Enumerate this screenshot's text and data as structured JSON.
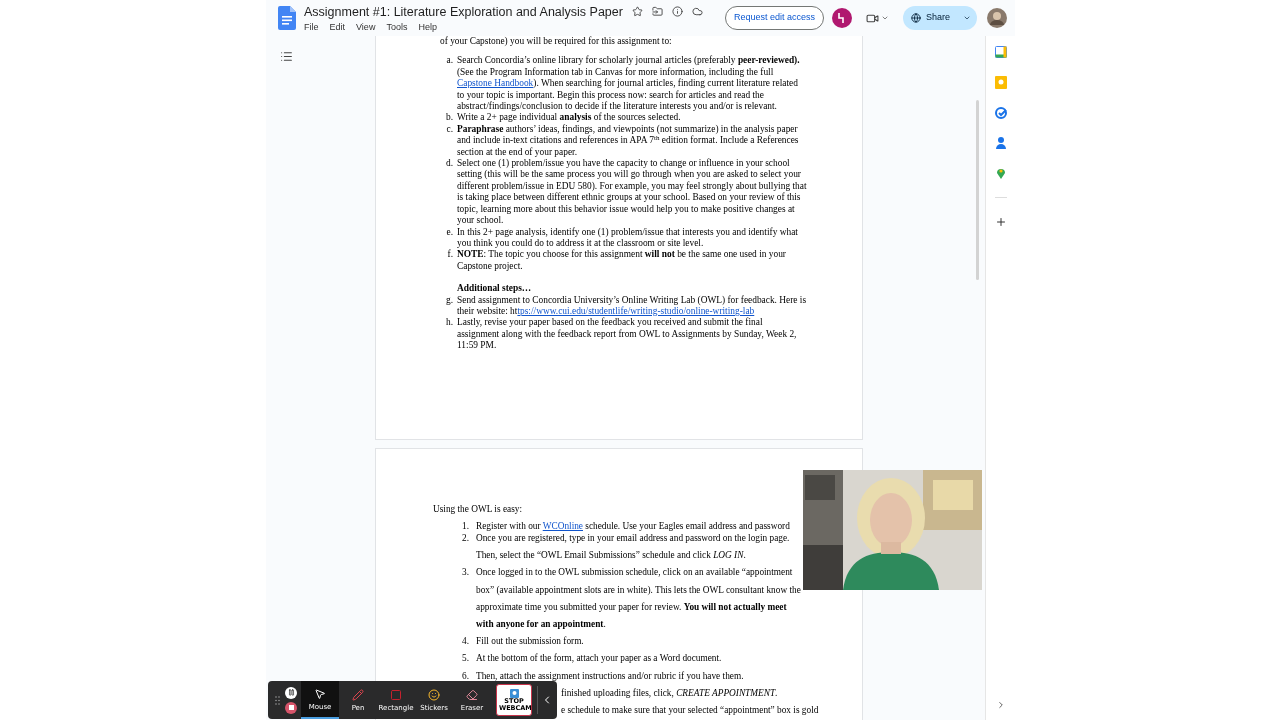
{
  "document": {
    "title": "Assignment #1: Literature Exploration and Analysis Paper",
    "menus": [
      "File",
      "Edit",
      "View",
      "Tools",
      "Help"
    ],
    "request_button": "Request edit access",
    "share_button": "Share"
  },
  "page1": {
    "lead": "of your Capstone) you will be required for this assignment to:",
    "items": [
      {
        "kind": "item",
        "marker": "a.",
        "parts": [
          {
            "kind": "text",
            "text": "Search Concordia’s online library for scholarly journal articles (preferably **peer-reviewed).** (See the Program Information tab in Canvas for more information, including the full "
          },
          {
            "kind": "link",
            "text": "Capstone Handbook"
          },
          {
            "kind": "text",
            "text": "). When searching for journal articles, finding current literature related to your topic is important. Begin this process now: search for articles and read the abstract/findings/conclusion to decide if the literature interests you and/or is relevant."
          }
        ]
      },
      {
        "kind": "item",
        "marker": "b.",
        "parts": [
          {
            "kind": "text",
            "text": "Write a 2+ page individual **analysis** of the sources selected."
          }
        ]
      },
      {
        "kind": "item",
        "marker": "c.",
        "parts": [
          {
            "kind": "text",
            "text": "**Paraphrase** authors’ ideas, findings, and viewpoints (not summarize) in the analysis paper and include in-text citations and references in APA 7$^{th}$ edition format. Include a References section at the end of your paper."
          }
        ]
      },
      {
        "kind": "item",
        "marker": "d.",
        "parts": [
          {
            "kind": "text",
            "text": "Select one (1) problem/issue you have the capacity to change or influence in your school setting (this will be the same process you will go through when you are asked to select your different problem/issue in EDU 580). For example, you may feel strongly about bullying that is taking place between different ethnic groups at your school. Based on your review of this topic, learning more about this behavior issue would help you to make positive changes at your school."
          }
        ]
      },
      {
        "kind": "item",
        "marker": "e.",
        "parts": [
          {
            "kind": "text",
            "text": "In this 2+ page analysis, identify one (1) problem/issue that interests you and identify what you think you could do to address it at the classroom or site level."
          }
        ]
      },
      {
        "kind": "item",
        "marker": "f.",
        "parts": [
          {
            "kind": "text",
            "text": "**NOTE**: The topic you choose for this assignment **will not** be the same one used in your Capstone project."
          }
        ]
      },
      {
        "kind": "heading",
        "text": "Additional steps…"
      },
      {
        "kind": "item",
        "marker": "g.",
        "parts": [
          {
            "kind": "text",
            "text": "Send assignment to Concordia University’s Online Writing Lab (OWL) for feedback. Here is their website: ht"
          },
          {
            "kind": "link",
            "text": "tps://www.cui.edu/studentlife/writing-studio/online-writing-lab"
          }
        ]
      },
      {
        "kind": "item",
        "marker": "h.",
        "parts": [
          {
            "kind": "text",
            "text": "Lastly, revise your paper based on the feedback you received and submit the final assignment along with the feedback report from OWL to Assignments by Sunday, Week 2, 11:59 PM."
          }
        ]
      }
    ]
  },
  "page2": {
    "intro": "Using the OWL is easy:",
    "steps": [
      {
        "kind": "full",
        "marker": "1.",
        "parts": [
          {
            "kind": "text",
            "text": "Register with our "
          },
          {
            "kind": "link",
            "text": "WCOnline"
          },
          {
            "kind": "text",
            "text": " schedule. Use your Eagles email address and password"
          }
        ]
      },
      {
        "kind": "full",
        "marker": "2.",
        "parts": [
          {
            "kind": "text",
            "text": "Once you are registered, type in your email address and password on the login page. Then, select the “OWL Email Submissions” schedule and click *LOG IN*."
          }
        ]
      },
      {
        "kind": "full",
        "marker": "3.",
        "parts": [
          {
            "kind": "text",
            "text": "Once logged in to the OWL submission schedule, click on an available “appointment box” (available appointment slots are in white). This lets the OWL consultant know the approximate time you submitted your paper for review. **You will not actually meet with anyone for an appointment**."
          }
        ]
      },
      {
        "kind": "full",
        "marker": "4.",
        "parts": [
          {
            "kind": "text",
            "text": "Fill out the submission form."
          }
        ]
      },
      {
        "kind": "full",
        "marker": "5.",
        "parts": [
          {
            "kind": "text",
            "text": "At the bottom of the form, attach your paper as a Word document."
          }
        ]
      },
      {
        "kind": "full",
        "marker": "6.",
        "parts": [
          {
            "kind": "text",
            "text": "Then, attach the assignment instructions and/or rubric if you have them."
          }
        ]
      },
      {
        "kind": "partial",
        "parts": [
          {
            "kind": "text",
            "text": "finished uploading files, click, *CREATE APPOINTMENT*."
          }
        ]
      },
      {
        "kind": "partial",
        "parts": [
          {
            "kind": "text",
            "text": "e schedule to make sure that your selected “appointment” box is gold"
          }
        ]
      }
    ]
  },
  "recorder": {
    "tools": [
      {
        "kind": "mouse",
        "label": "Mouse",
        "selected": true
      },
      {
        "kind": "pen",
        "label": "Pen",
        "selected": false
      },
      {
        "kind": "rectangle",
        "label": "Rectangle",
        "selected": false
      },
      {
        "kind": "stickers",
        "label": "Stickers",
        "selected": false
      },
      {
        "kind": "eraser",
        "label": "Eraser",
        "selected": false
      }
    ],
    "stop_webcam": "STOP WEBCAM"
  }
}
